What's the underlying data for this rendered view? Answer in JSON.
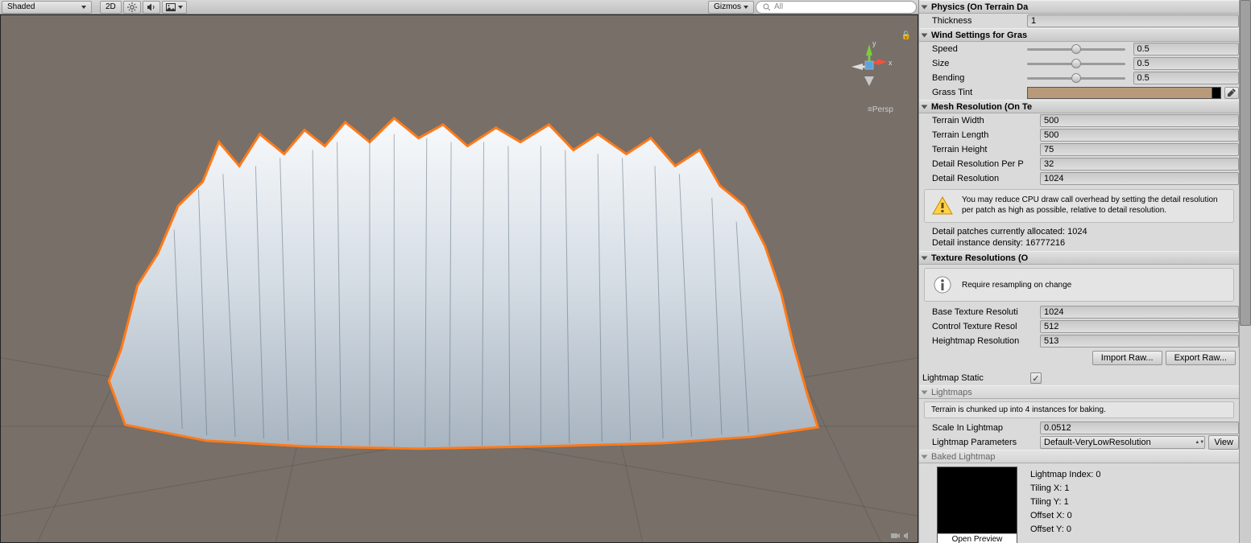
{
  "scene": {
    "shading_mode": "Shaded",
    "toolbar_2d": "2D",
    "gizmos_label": "Gizmos",
    "search_placeholder": "All",
    "persp_label": "≡Persp"
  },
  "inspector": {
    "physics": {
      "header": "Physics (On Terrain Da",
      "thickness_label": "Thickness",
      "thickness_value": "1"
    },
    "wind": {
      "header": "Wind Settings for Gras",
      "speed_label": "Speed",
      "speed_value": "0.5",
      "size_label": "Size",
      "size_value": "0.5",
      "bending_label": "Bending",
      "bending_value": "0.5",
      "tint_label": "Grass Tint",
      "tint_color": "#b89a7a"
    },
    "mesh": {
      "header": "Mesh Resolution (On Te",
      "width_label": "Terrain Width",
      "width_value": "500",
      "length_label": "Terrain Length",
      "length_value": "500",
      "height_label": "Terrain Height",
      "height_value": "75",
      "detail_per_patch_label": "Detail Resolution Per P",
      "detail_per_patch_value": "32",
      "detail_res_label": "Detail Resolution",
      "detail_res_value": "1024",
      "help": "You may reduce CPU draw call overhead by setting the detail resolution per patch as high as possible, relative to detail resolution.",
      "patches_line": "Detail patches currently allocated: 1024",
      "density_line": "Detail instance density: 16777216"
    },
    "texture": {
      "header": "Texture Resolutions (O",
      "help": "Require resampling on change",
      "base_label": "Base Texture Resoluti",
      "base_value": "1024",
      "control_label": "Control Texture Resol",
      "control_value": "512",
      "height_label": "Heightmap Resolution",
      "height_value": "513",
      "import_btn": "Import Raw...",
      "export_btn": "Export Raw..."
    },
    "lightmap_static": {
      "label": "Lightmap Static",
      "checked": true
    },
    "lightmaps": {
      "header": "Lightmaps",
      "sub_info": "Terrain is chunked up into 4 instances for baking.",
      "scale_label": "Scale In Lightmap",
      "scale_value": "0.0512",
      "params_label": "Lightmap Parameters",
      "params_value": "Default-VeryLowResolution",
      "view_btn": "View"
    },
    "baked": {
      "header": "Baked Lightmap",
      "open_preview": "Open Preview",
      "index": "Lightmap Index: 0",
      "tiling_x": "Tiling X: 1",
      "tiling_y": "Tiling Y: 1",
      "offset_x": "Offset X: 0",
      "offset_y": "Offset Y: 0"
    }
  }
}
